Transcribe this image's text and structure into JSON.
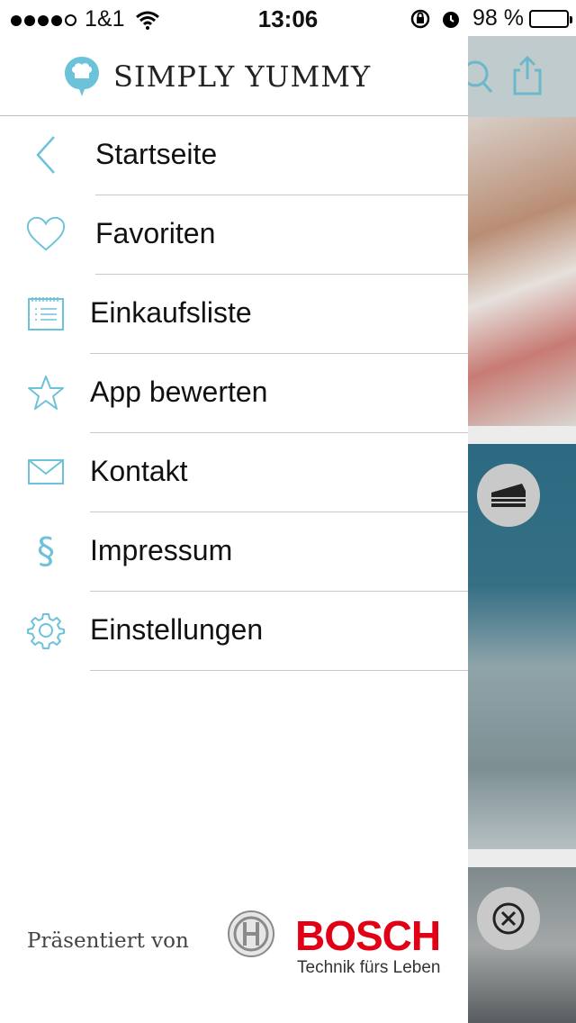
{
  "status_bar": {
    "carrier": "1&1",
    "time": "13:06",
    "battery": "98 %",
    "battery_level": 0.98
  },
  "app": {
    "title": "SIMPLY YUMMY"
  },
  "menu": {
    "items": [
      {
        "label": "Startseite",
        "icon": "chevron-left-icon"
      },
      {
        "label": "Favoriten",
        "icon": "heart-icon"
      },
      {
        "label": "Einkaufsliste",
        "icon": "notepad-list-icon"
      },
      {
        "label": "App bewerten",
        "icon": "star-icon"
      },
      {
        "label": "Kontakt",
        "icon": "envelope-icon"
      },
      {
        "label": "Impressum",
        "icon": "section-sign-icon"
      },
      {
        "label": "Einstellungen",
        "icon": "gear-icon"
      }
    ]
  },
  "footer": {
    "presented_by": "Präsentiert von",
    "sponsor_name": "BOSCH",
    "sponsor_tagline": "Technik fürs Leben"
  },
  "colors": {
    "accent": "#6cc3d9",
    "sponsor_red": "#e20015"
  }
}
